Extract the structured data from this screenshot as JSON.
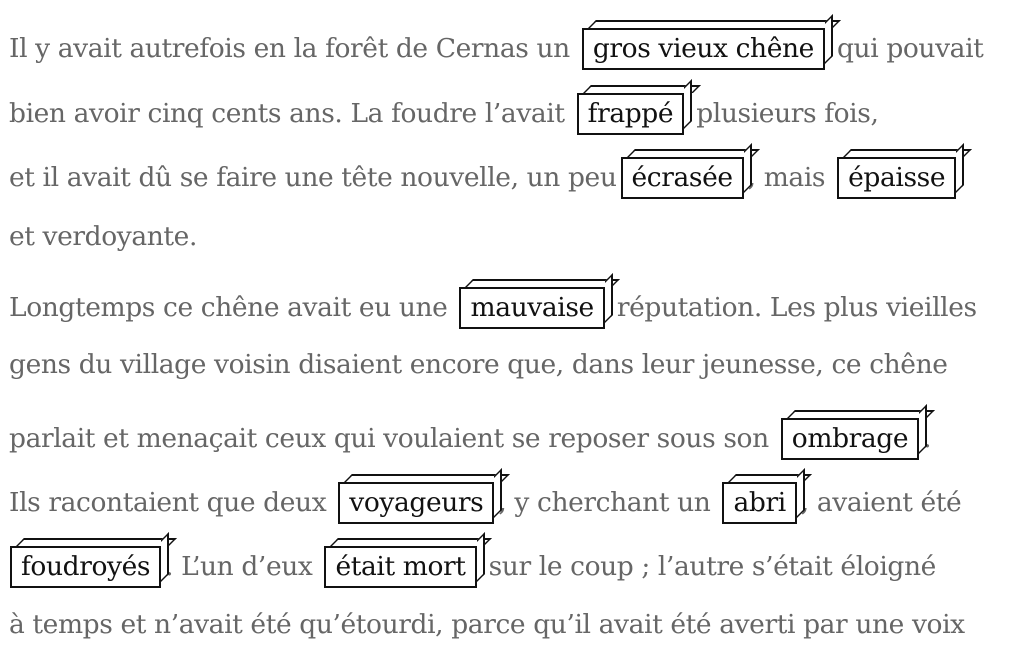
{
  "paragraph1": {
    "line1": {
      "before": "Il y avait autrefois en la forêt de Cernas un",
      "word": "gros vieux chêne",
      "after": "qui pouvait"
    },
    "line2": {
      "before": "bien avoir cinq cents ans. La foudre l’avait",
      "word": "frappé",
      "after": "plusieurs fois,"
    },
    "line3": {
      "before": "et il avait dû se faire une tête nouvelle, un peu",
      "word1": "écrasée",
      "middle": ", mais",
      "word2": "épaisse"
    },
    "line4": {
      "text": "et verdoyante."
    }
  },
  "paragraph2": {
    "line5": {
      "before": "Longtemps ce chêne avait eu une",
      "word": "mauvaise",
      "after": "réputation. Les plus vieilles"
    },
    "line6": {
      "text": "gens du village voisin disaient encore que, dans leur jeunesse, ce chêne"
    },
    "line7": {
      "before": "parlait et menaçait ceux qui voulaient se reposer sous son",
      "word": "ombrage",
      "after": "."
    },
    "line8": {
      "before": "Ils racontaient que deux",
      "word1": "voyageurs",
      "middle": ", y cherchant un",
      "word2": "abri",
      "after": ", avaient été"
    },
    "line9": {
      "word1": "foudroyés",
      "middle": ". L’un d’eux",
      "word2": "était mort",
      "after": "sur le coup ; l’autre s’était éloigné"
    },
    "line10": {
      "text": "à temps et n’avait été qu’étourdi, parce qu’il avait été averti par une voix"
    }
  }
}
